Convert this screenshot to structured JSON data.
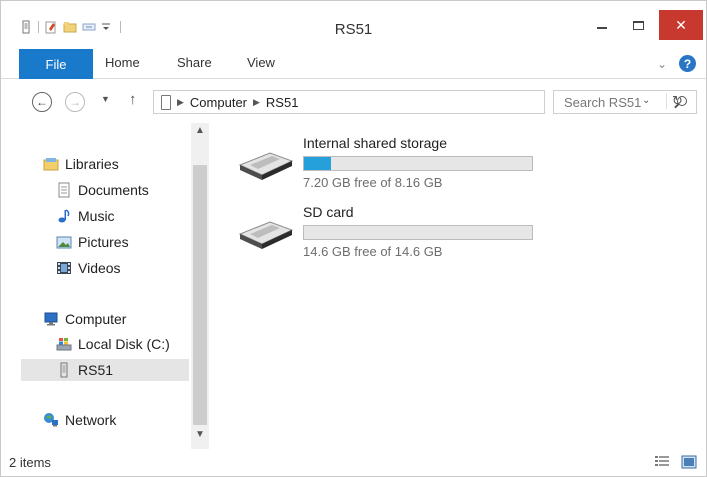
{
  "window": {
    "title": "RS51"
  },
  "titlebar": {
    "minimize": "minimize",
    "maximize": "maximize",
    "close": "✕"
  },
  "ribbon": {
    "tabs": [
      "File",
      "Home",
      "Share",
      "View"
    ],
    "help": "?"
  },
  "address": {
    "crumbs": [
      "Computer",
      "RS51"
    ],
    "search_placeholder": "Search RS51"
  },
  "nav": {
    "libraries": "Libraries",
    "documents": "Documents",
    "music": "Music",
    "pictures": "Pictures",
    "videos": "Videos",
    "computer": "Computer",
    "local_disk": "Local Disk (C:)",
    "rs51": "RS51",
    "network": "Network"
  },
  "drives": [
    {
      "name": "Internal shared storage",
      "free_text": "7.20 GB free of 8.16 GB",
      "used_fraction": 0.118
    },
    {
      "name": "SD card",
      "free_text": "14.6 GB free of 14.6 GB",
      "used_fraction": 0.0
    }
  ],
  "status": {
    "items": "2 items"
  },
  "colors": {
    "accent": "#1979ca",
    "close": "#c7392f",
    "progress": "#26a0da"
  }
}
